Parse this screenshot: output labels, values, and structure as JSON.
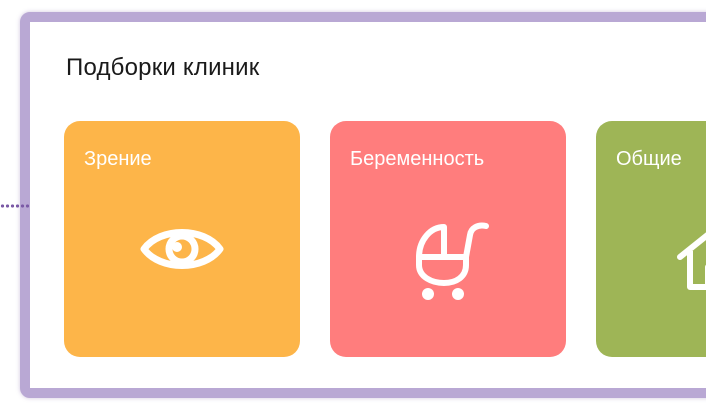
{
  "section": {
    "title": "Подборки клиник"
  },
  "cards": [
    {
      "label": "Зрение",
      "color": "#FDB549",
      "icon": "eye-icon"
    },
    {
      "label": "Беременность",
      "color": "#FF7D7D",
      "icon": "baby-stroller-icon"
    },
    {
      "label": "Общие",
      "color": "#9EB556",
      "icon": "house-icon"
    }
  ]
}
